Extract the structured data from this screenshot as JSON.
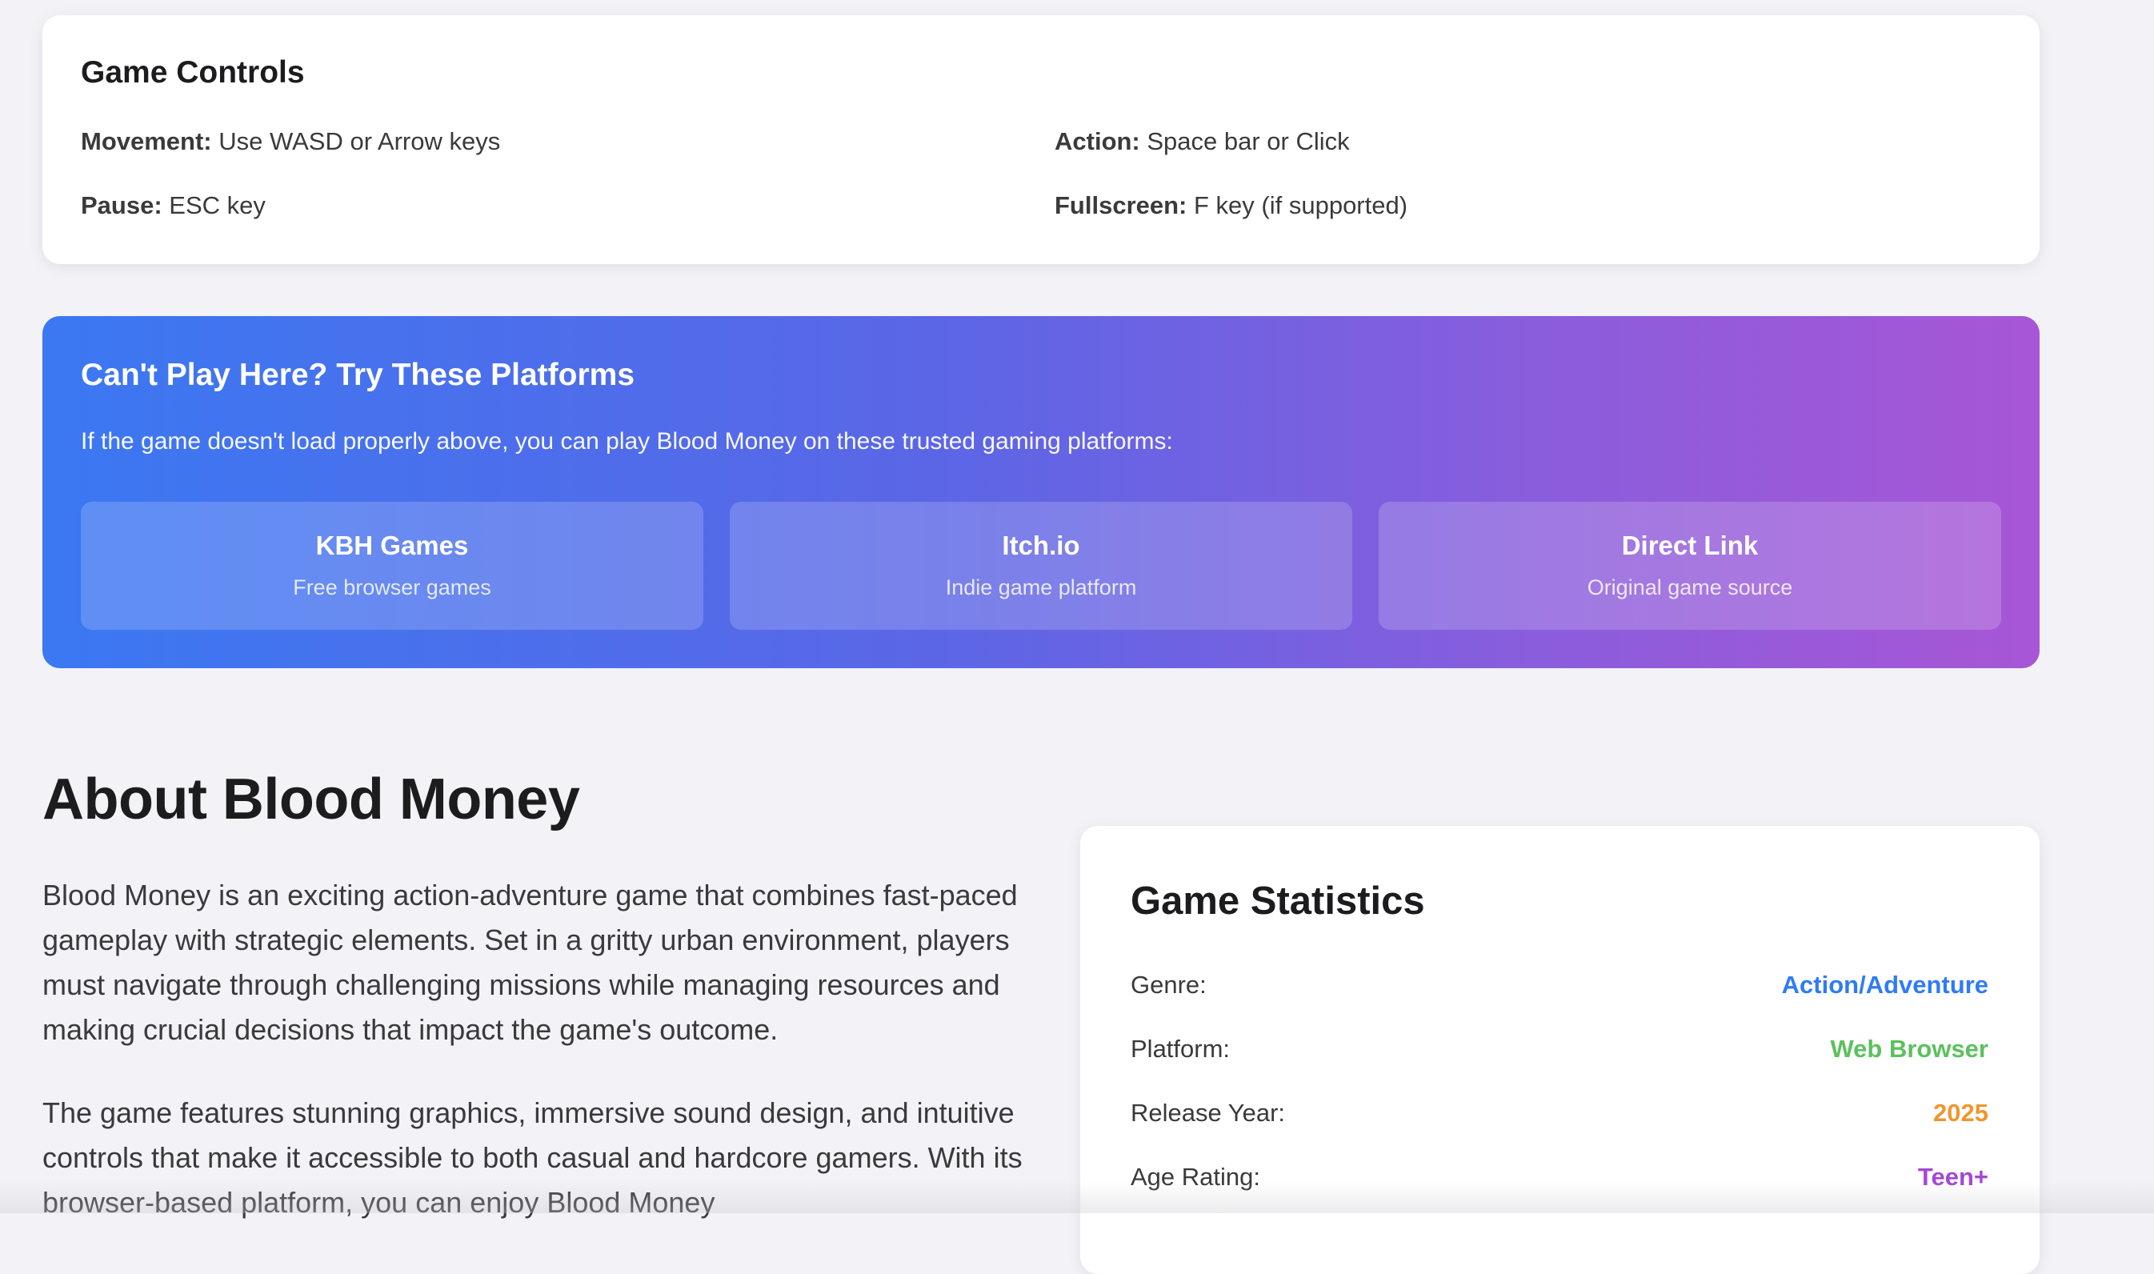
{
  "controls": {
    "title": "Game Controls",
    "items": [
      {
        "label": "Movement:",
        "value": " Use WASD or Arrow keys"
      },
      {
        "label": "Action:",
        "value": " Space bar or Click"
      },
      {
        "label": "Pause:",
        "value": " ESC key"
      },
      {
        "label": "Fullscreen:",
        "value": " F key (if supported)"
      }
    ]
  },
  "platforms": {
    "title": "Can't Play Here? Try These Platforms",
    "description": "If the game doesn't load properly above, you can play Blood Money on these trusted gaming platforms:",
    "cards": [
      {
        "name": "KBH Games",
        "subtitle": "Free browser games"
      },
      {
        "name": "Itch.io",
        "subtitle": "Indie game platform"
      },
      {
        "name": "Direct Link",
        "subtitle": "Original game source"
      }
    ],
    "gradient_colors": [
      "#3b78f2",
      "#a756d6"
    ]
  },
  "about": {
    "title": "About Blood Money",
    "paragraph1": "Blood Money is an exciting action-adventure game that combines fast-paced gameplay with strategic elements. Set in a gritty urban environment, players must navigate through challenging missions while managing resources and making crucial decisions that impact the game's outcome.",
    "paragraph2": "The game features stunning graphics, immersive sound design, and intuitive controls that make it accessible to both casual and hardcore gamers. With its browser-based platform, you can enjoy Blood Money"
  },
  "stats": {
    "title": "Game Statistics",
    "rows": [
      {
        "label": "Genre:",
        "value": "Action/Adventure",
        "color": "#2f7bf6"
      },
      {
        "label": "Platform:",
        "value": "Web Browser",
        "color": "#5cc05e"
      },
      {
        "label": "Release Year:",
        "value": "2025",
        "color": "#f0962e"
      },
      {
        "label": "Age Rating:",
        "value": "Teen+",
        "color": "#a447d6"
      }
    ]
  }
}
